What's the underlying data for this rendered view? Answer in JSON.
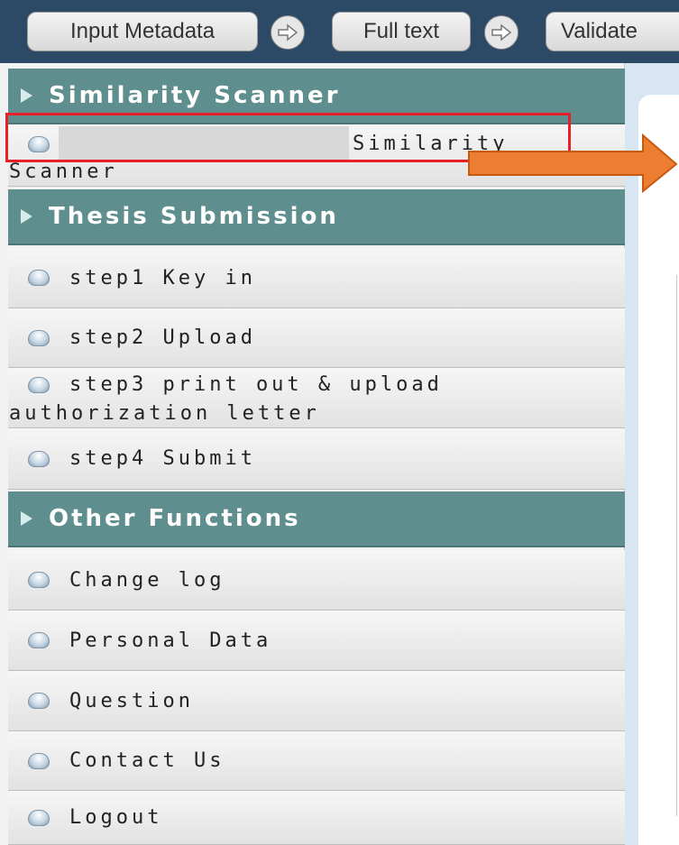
{
  "topbar": {
    "steps": [
      {
        "label": "Input Metadata"
      },
      {
        "label": "Full text"
      },
      {
        "label": "Validate"
      }
    ],
    "arrow_icon": "right-arrow-circle-icon"
  },
  "sidebar": {
    "sections": [
      {
        "title": "Similarity Scanner",
        "items": [
          {
            "label": "Similarity",
            "label_cont": "Scanner"
          }
        ]
      },
      {
        "title": "Thesis Submission",
        "items": [
          {
            "label": "step1 Key in"
          },
          {
            "label": "step2 Upload"
          },
          {
            "label": "step3 print out & upload",
            "label_cont": "authorization letter"
          },
          {
            "label": "step4 Submit"
          }
        ]
      },
      {
        "title": "Other Functions",
        "items": [
          {
            "label": "Change log"
          },
          {
            "label": "Personal Data"
          },
          {
            "label": "Question"
          },
          {
            "label": "Contact Us"
          },
          {
            "label": "Logout"
          }
        ]
      }
    ]
  },
  "annotation": {
    "highlight_color": "#e8202a",
    "arrow_color": "#ed7d31"
  }
}
